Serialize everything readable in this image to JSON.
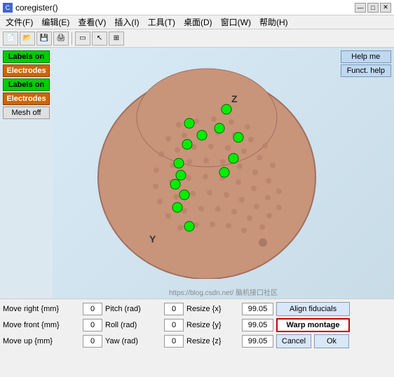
{
  "titlebar": {
    "title": "coregister()",
    "icon": "C",
    "min_label": "—",
    "max_label": "□",
    "close_label": "✕"
  },
  "menubar": {
    "items": [
      {
        "label": "文件(F)"
      },
      {
        "label": "编辑(E)"
      },
      {
        "label": "查看(V)"
      },
      {
        "label": "插入(I)"
      },
      {
        "label": "工具(T)"
      },
      {
        "label": "桌面(D)"
      },
      {
        "label": "窗口(W)"
      },
      {
        "label": "帮助(H)"
      }
    ]
  },
  "left_panel": {
    "btn_labels_on_1": "Labels on",
    "btn_electrodes_1": "Electrodes",
    "btn_labels_on_2": "Labels on",
    "btn_electrodes_2": "Electrodes",
    "btn_mesh_off": "Mesh off"
  },
  "right_help": {
    "btn_help": "Help me",
    "btn_funct_help": "Funct. help"
  },
  "axis_labels": {
    "z": "Z",
    "y": "Y"
  },
  "bottom": {
    "rows": [
      {
        "label1": "Move right {mm}",
        "val1": "0",
        "label2": "Pitch (rad)",
        "val2": "0",
        "label3": "Resize {x}",
        "val3": "99.05",
        "btn": "Align fiducials"
      },
      {
        "label1": "Move front {mm}",
        "val1": "0",
        "label2": "Roll (rad)",
        "val2": "0",
        "label3": "Resize {y}",
        "val3": "99.05",
        "btn": "Warp montage"
      },
      {
        "label1": "Move up {mm}",
        "val1": "0",
        "label2": "Yaw (rad)",
        "val2": "0",
        "label3": "Resize {z}",
        "val3": "99.05",
        "btn_cancel": "Cancel",
        "btn_ok": "Ok"
      }
    ]
  },
  "watermark": "https://blog.csdn.net/ 脑机接口社区"
}
